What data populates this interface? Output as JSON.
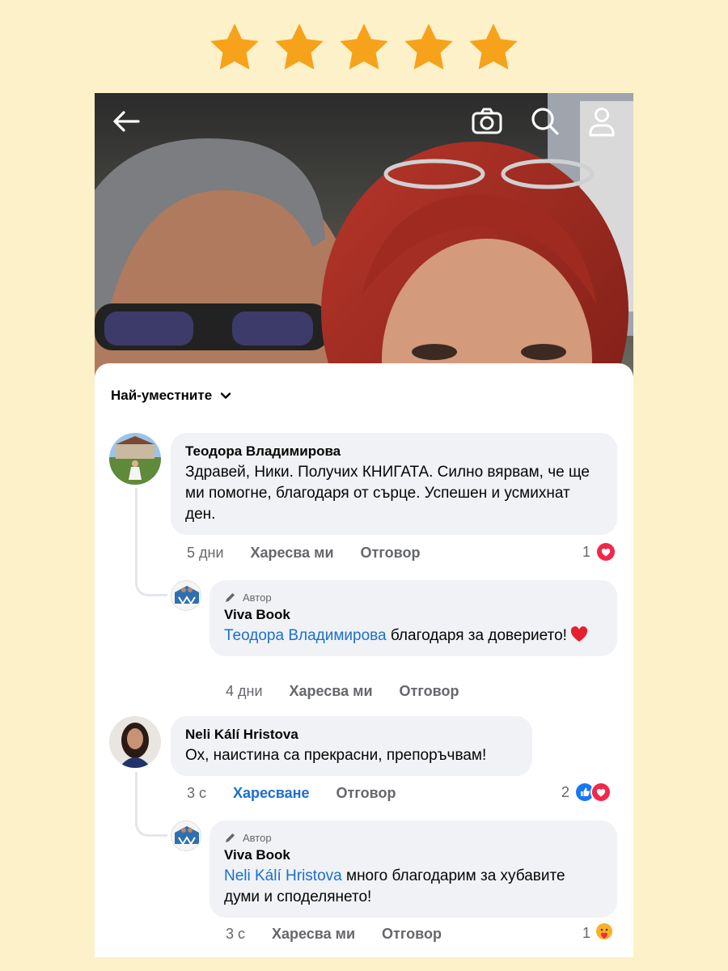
{
  "rating": {
    "stars": 5,
    "max": 5,
    "color": "#f7a21b"
  },
  "top_bar": {
    "icons": [
      "back-arrow-icon",
      "camera-icon",
      "search-icon",
      "profile-icon"
    ],
    "icon_color": "#ffffff"
  },
  "comments_header": {
    "sort_label": "Най-уместните"
  },
  "comments": [
    {
      "author": "Теодора Владимирова",
      "text": "Здравей, Ники. Получих КНИГАТА. Силно вярвам, че ще ми помогне, благодаря от сърце. Успешен и усмихнат ден.",
      "time": "5 дни",
      "like_label": "Харесва ми",
      "reply_label": "Отговор",
      "reaction_count": "1",
      "reactions": [
        "heart-reaction-icon"
      ],
      "reply": {
        "badge": "Автор",
        "author": "Viva Book",
        "mention": "Теодора Владимирова",
        "text": "благодаря за доверието!",
        "emoji": "red-heart-emoji-icon",
        "time": "4 дни",
        "like_label": "Харесва ми",
        "reply_label": "Отговор"
      }
    },
    {
      "author": "Neli Kálí Hristova",
      "text": "Ох, наистина са прекрасни, препоръчвам!",
      "time": "3 с",
      "like_label": "Харесване",
      "reply_label": "Отговор",
      "reaction_count": "2",
      "reactions": [
        "like-reaction-icon",
        "heart-reaction-icon"
      ],
      "reply": {
        "badge": "Автор",
        "author": "Viva Book",
        "mention": "Neli Kálí Hristova",
        "text": "много благодарим за хубавите думи и споделянето!",
        "time": "3 с",
        "like_label": "Харесва ми",
        "reply_label": "Отговор",
        "reaction_count": "1",
        "reactions": [
          "care-reaction-icon"
        ]
      }
    }
  ],
  "colors": {
    "background": "#fcf1c9",
    "link": "#1b6fcf",
    "bubble": "#f0f2f5",
    "muted": "#65676b"
  }
}
